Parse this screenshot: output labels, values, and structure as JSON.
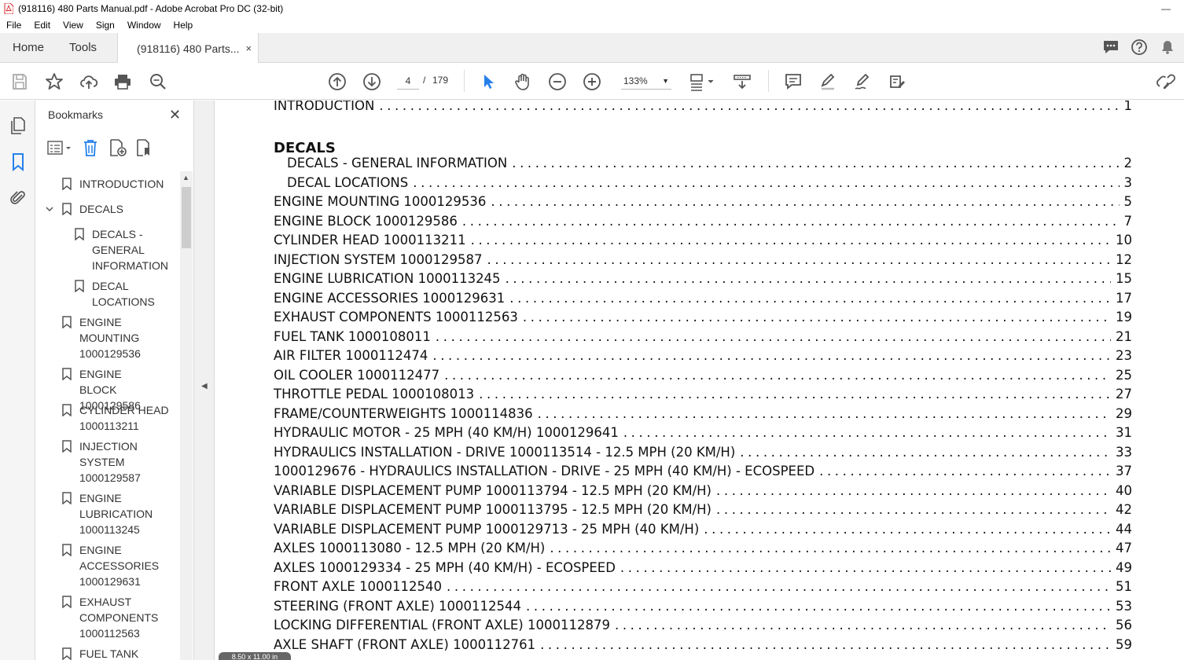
{
  "window": {
    "title": "(918116) 480 Parts Manual.pdf - Adobe Acrobat Pro DC (32-bit)",
    "minimize": "—"
  },
  "menu": [
    "File",
    "Edit",
    "View",
    "Sign",
    "Window",
    "Help"
  ],
  "tabs": {
    "home": "Home",
    "tools": "Tools",
    "document": "(918116) 480 Parts...",
    "close": "×"
  },
  "toolbar": {
    "page_current": "4",
    "page_separator": "/",
    "page_total": "179",
    "zoom": "133%"
  },
  "bookmarks": {
    "title": "Bookmarks",
    "close": "✕",
    "items": [
      {
        "label": "INTRODUCTION"
      },
      {
        "label": "DECALS"
      },
      {
        "label": "DECALS - GENERAL INFORMATION"
      },
      {
        "label": "DECAL LOCATIONS"
      },
      {
        "label": "ENGINE MOUNTING 1000129536"
      },
      {
        "label": "ENGINE BLOCK 1000129586"
      },
      {
        "label": "CYLINDER HEAD 1000113211"
      },
      {
        "label": "INJECTION SYSTEM 1000129587"
      },
      {
        "label": "ENGINE LUBRICATION 1000113245"
      },
      {
        "label": "ENGINE ACCESSORIES 1000129631"
      },
      {
        "label": "EXHAUST COMPONENTS 1000112563"
      },
      {
        "label": "FUEL TANK"
      }
    ]
  },
  "document": {
    "toc": [
      {
        "title": "INTRODUCTION",
        "page": "1"
      },
      {
        "section": "DECALS"
      },
      {
        "title": "DECALS - GENERAL INFORMATION",
        "page": "2"
      },
      {
        "title": "DECAL LOCATIONS",
        "page": "3"
      },
      {
        "title": "ENGINE MOUNTING 1000129536",
        "page": "5"
      },
      {
        "title": "ENGINE BLOCK 1000129586",
        "page": "7"
      },
      {
        "title": "CYLINDER HEAD 1000113211",
        "page": "10"
      },
      {
        "title": "INJECTION SYSTEM 1000129587",
        "page": "12"
      },
      {
        "title": "ENGINE LUBRICATION 1000113245",
        "page": "15"
      },
      {
        "title": "ENGINE ACCESSORIES 1000129631",
        "page": "17"
      },
      {
        "title": "EXHAUST COMPONENTS 1000112563",
        "page": "19"
      },
      {
        "title": "FUEL TANK 1000108011",
        "page": "21"
      },
      {
        "title": "AIR FILTER 1000112474",
        "page": "23"
      },
      {
        "title": "OIL COOLER 1000112477",
        "page": "25"
      },
      {
        "title": "THROTTLE PEDAL 1000108013",
        "page": "27"
      },
      {
        "title": "FRAME/COUNTERWEIGHTS 1000114836",
        "page": "29"
      },
      {
        "title": "HYDRAULIC MOTOR - 25 MPH (40 KM/H) 1000129641",
        "page": "31"
      },
      {
        "title": "HYDRAULICS INSTALLATION - DRIVE 1000113514 - 12.5 MPH (20 KM/H)",
        "page": "33"
      },
      {
        "title": "1000129676  - HYDRAULICS INSTALLATION - DRIVE - 25 MPH (40 KM/H) - ECOSPEED",
        "page": "37"
      },
      {
        "title": "VARIABLE DISPLACEMENT PUMP 1000113794 - 12.5 MPH (20 KM/H)",
        "page": "40"
      },
      {
        "title": "VARIABLE DISPLACEMENT PUMP 1000113795 - 12.5 MPH (20 KM/H)",
        "page": "42"
      },
      {
        "title": "VARIABLE DISPLACEMENT PUMP 1000129713 - 25 MPH (40 KM/H)",
        "page": "44"
      },
      {
        "title": "AXLES 1000113080 - 12.5 MPH (20 KM/H)",
        "page": "47"
      },
      {
        "title": "AXLES 1000129334 - 25 MPH (40 KM/H) - ECOSPEED",
        "page": "49"
      },
      {
        "title": "FRONT AXLE 1000112540",
        "page": "51"
      },
      {
        "title": "STEERING (FRONT AXLE) 1000112544",
        "page": "53"
      },
      {
        "title": "LOCKING DIFFERENTIAL (FRONT AXLE) 1000112879",
        "page": "56"
      },
      {
        "title": "AXLE SHAFT (FRONT AXLE) 1000112761",
        "page": "59"
      }
    ],
    "page_size": "8.50 x 11.00 in"
  },
  "colors": {
    "accent_blue": "#2680eb",
    "icon_gray": "#555555"
  }
}
